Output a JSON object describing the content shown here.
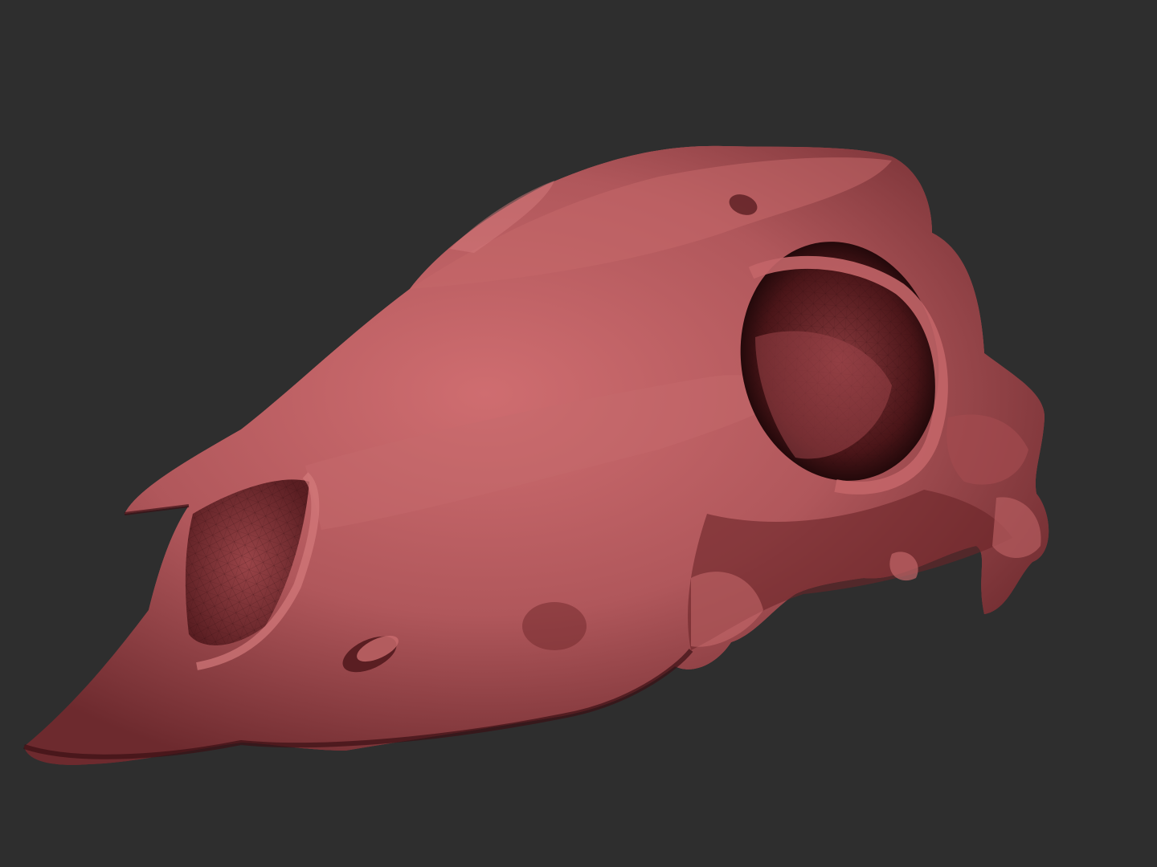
{
  "scene": {
    "background_color": "#2e2e2e",
    "model": {
      "subject": "animal-skull-mesh",
      "view": "side-three-quarter",
      "display_mode": "wireframe-over-shaded",
      "material_color": "#b8585c",
      "material_highlight": "#d9787a",
      "material_shadow": "#3a1014",
      "wire_color": "#2a0a0c"
    }
  }
}
